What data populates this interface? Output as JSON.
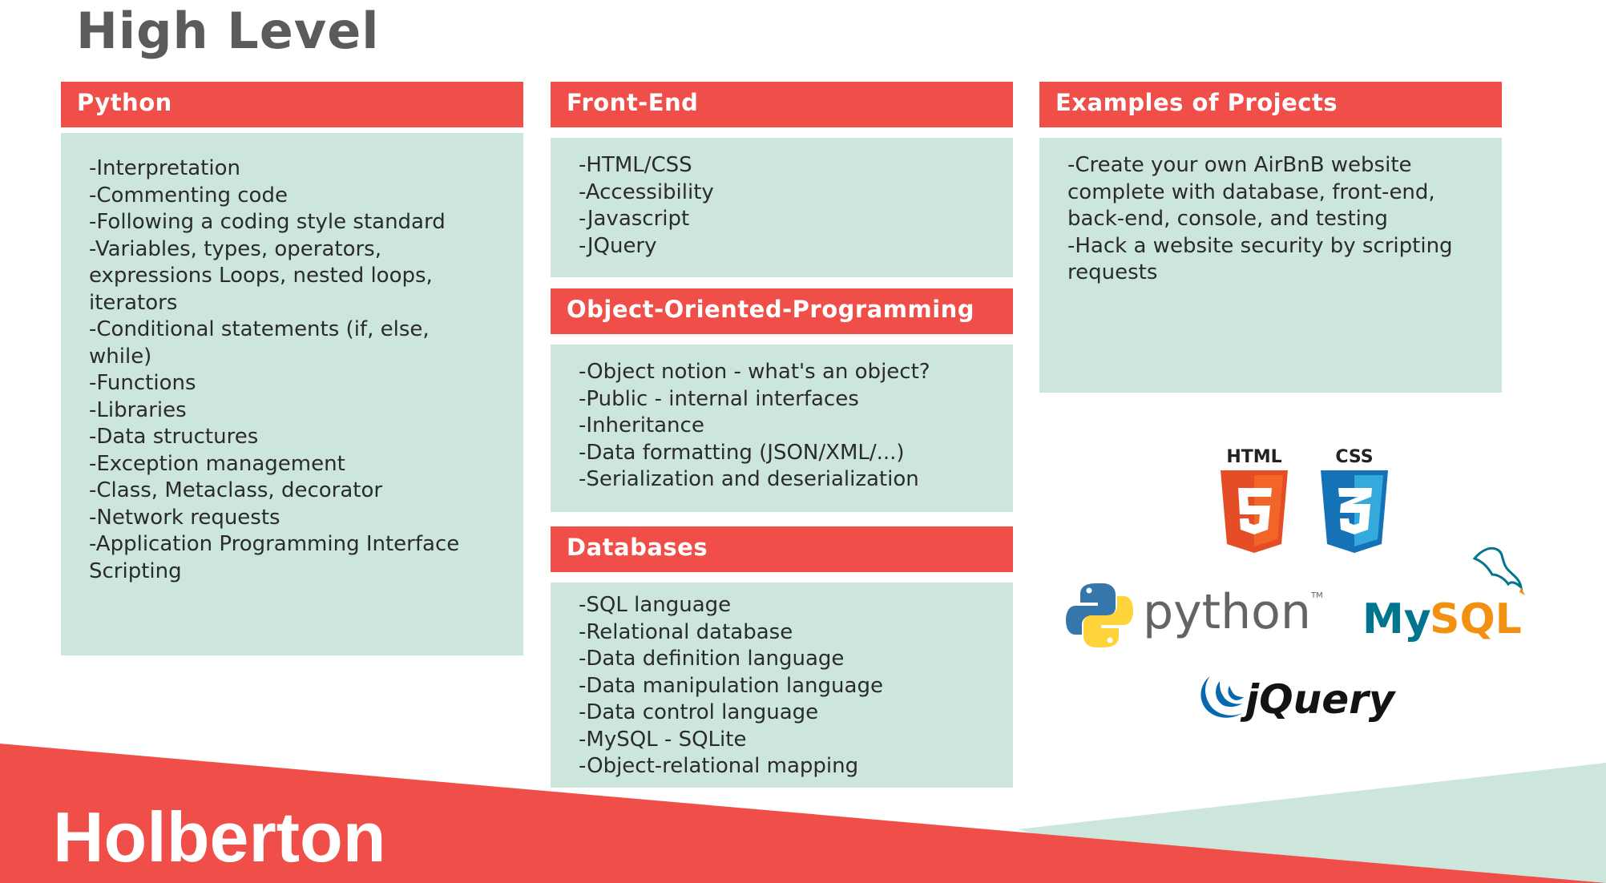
{
  "page": {
    "title": "High Level",
    "brand": "Holberton"
  },
  "columns": {
    "python": {
      "header": "Python",
      "items": [
        "-Interpretation",
        "-Commenting code",
        "-Following a coding style standard",
        "-Variables, types, operators,",
        "expressions Loops, nested loops,",
        "iterators",
        "-Conditional statements (if, else,",
        "while)",
        "-Functions",
        "-Libraries",
        "-Data structures",
        "-Exception management",
        "-Class, Metaclass, decorator",
        "-Network requests",
        "-Application Programming Interface",
        "Scripting"
      ]
    },
    "frontend": {
      "header": "Front-End",
      "items": [
        "-HTML/CSS",
        "-Accessibility",
        "-Javascript",
        "-JQuery"
      ]
    },
    "oop": {
      "header": "Object-Oriented-Programming",
      "items": [
        "-Object notion - what's an object?",
        "-Public - internal interfaces",
        "-Inheritance",
        "-Data formatting (JSON/XML/...)",
        "-Serialization and deserialization"
      ]
    },
    "databases": {
      "header": "Databases",
      "items": [
        "-SQL language",
        "-Relational database",
        "-Data definition language",
        "-Data manipulation language",
        "-Data control language",
        "-MySQL - SQLite",
        "-Object-relational mapping"
      ]
    },
    "projects": {
      "header": "Examples of Projects",
      "items": [
        "-Create your own AirBnB website",
        "complete with database, front-end,",
        "back-end, console, and testing",
        "-Hack a website security by scripting",
        "requests"
      ]
    }
  },
  "logos": {
    "html": "HTML",
    "html_digit": "5",
    "css": "CSS",
    "css_digit": "3",
    "python": "python",
    "python_tm": "TM",
    "mysql_my": "My",
    "mysql_sql": "SQL",
    "jquery": "jQuery"
  },
  "colors": {
    "header_red": "#ef4f48",
    "box_mint": "#cce6dc",
    "title_gray": "#5b5b5b",
    "html_orange": "#e44d26",
    "css_blue": "#1572b6",
    "mysql_blue": "#00758f",
    "mysql_orange": "#f29111"
  },
  "icons": [
    "html5-logo-icon",
    "css3-logo-icon",
    "python-logo-icon",
    "mysql-dolphin-icon",
    "jquery-logo-icon"
  ]
}
